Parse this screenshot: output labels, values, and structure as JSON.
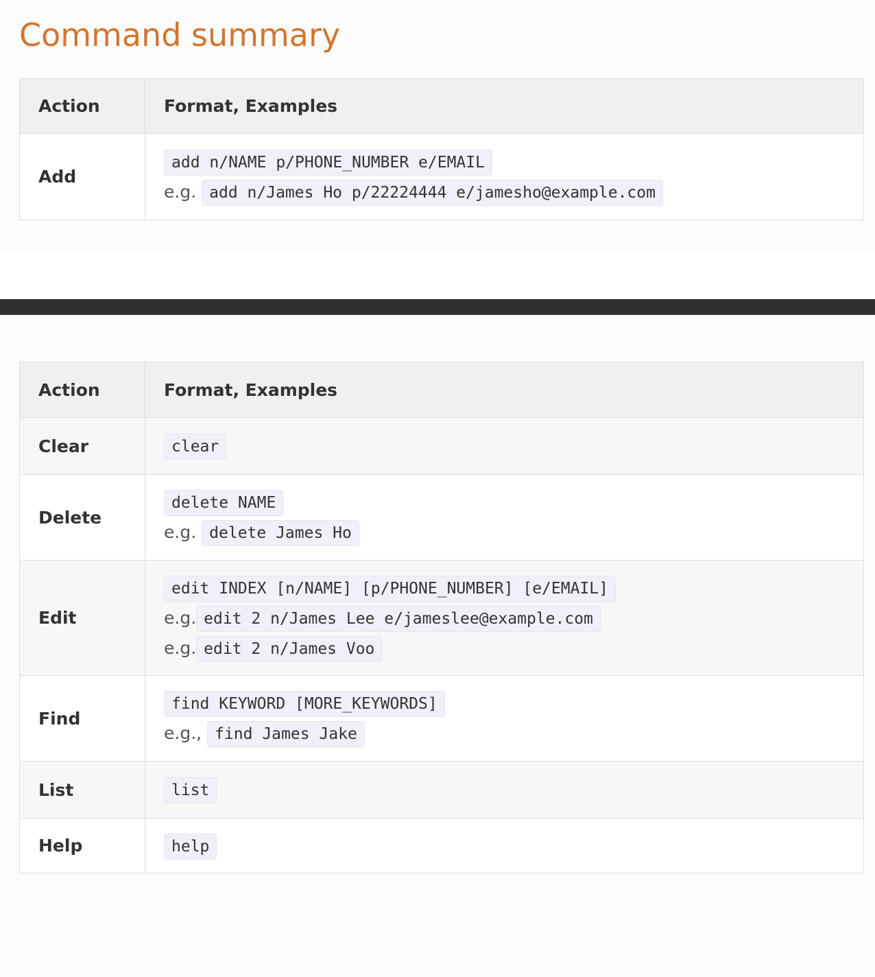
{
  "page": {
    "title": "Command summary",
    "title_color": "#d2752f"
  },
  "table_top": {
    "header": {
      "action": "Action",
      "format": "Format, Examples"
    },
    "rows": [
      {
        "action": "Add",
        "format": "add n/NAME p/PHONE_NUMBER e/EMAIL",
        "examples": [
          {
            "prefix": "e.g.",
            "code": "add n/James Ho p/22224444 e/jamesho@example.com"
          }
        ]
      }
    ]
  },
  "table_bottom": {
    "header": {
      "action": "Action",
      "format": "Format, Examples"
    },
    "rows": [
      {
        "action": "Clear",
        "format": "clear",
        "examples": []
      },
      {
        "action": "Delete",
        "format": "delete NAME",
        "examples": [
          {
            "prefix": "e.g.",
            "code": "delete James Ho"
          }
        ]
      },
      {
        "action": "Edit",
        "format": "edit INDEX [n/NAME] [p/PHONE_NUMBER] [e/EMAIL]",
        "examples": [
          {
            "prefix": "e.g.",
            "code": "edit 2 n/James Lee e/jameslee@example.com"
          },
          {
            "prefix": "e.g.",
            "code": "edit 2 n/James Voo"
          }
        ]
      },
      {
        "action": "Find",
        "format": "find KEYWORD [MORE_KEYWORDS]",
        "examples": [
          {
            "prefix": "e.g.,",
            "code": "find James Jake"
          }
        ]
      },
      {
        "action": "List",
        "format": "list",
        "examples": []
      },
      {
        "action": "Help",
        "format": "help",
        "examples": []
      }
    ]
  },
  "colors": {
    "accent": "#d2752f",
    "divider": "#2f2f2f",
    "code_bg": "#f0f0f8"
  }
}
